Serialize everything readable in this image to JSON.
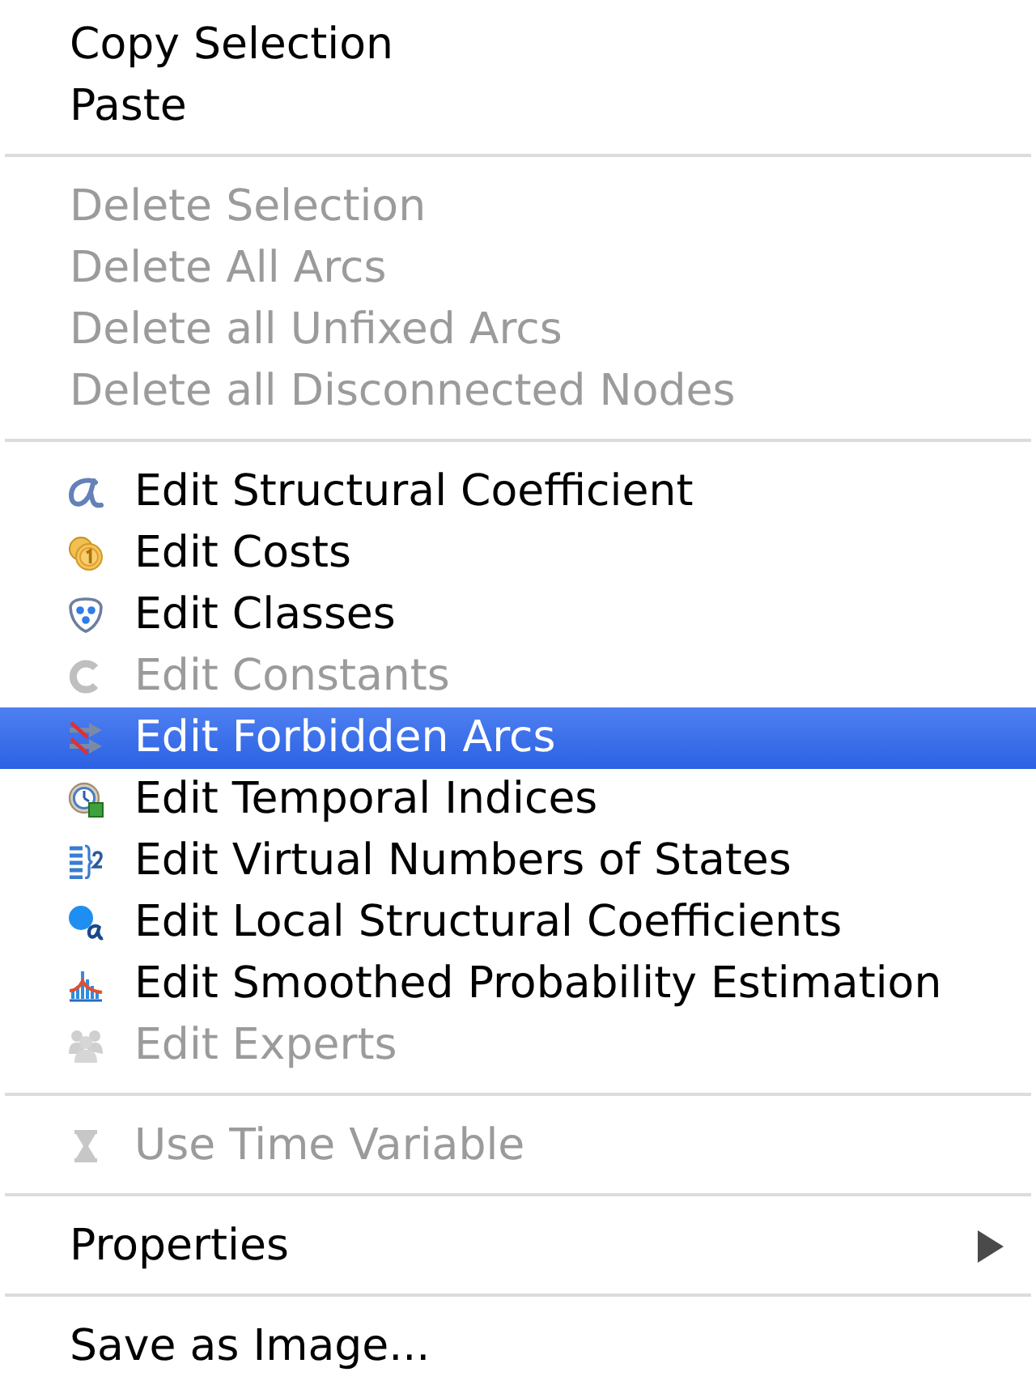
{
  "menu": {
    "sections": [
      {
        "items": [
          {
            "label": "Copy Selection",
            "disabled": false,
            "selected": false,
            "submenu": false
          },
          {
            "label": "Paste",
            "disabled": false,
            "selected": false,
            "submenu": false
          }
        ]
      },
      {
        "items": [
          {
            "label": "Delete Selection",
            "disabled": true,
            "selected": false,
            "submenu": false
          },
          {
            "label": "Delete All Arcs",
            "disabled": true,
            "selected": false,
            "submenu": false
          },
          {
            "label": "Delete all Unfixed Arcs",
            "disabled": true,
            "selected": false,
            "submenu": false
          },
          {
            "label": "Delete all Disconnected Nodes",
            "disabled": true,
            "selected": false,
            "submenu": false
          }
        ]
      },
      {
        "items": [
          {
            "label": "Edit Structural Coefficient",
            "disabled": false,
            "selected": false,
            "submenu": false
          },
          {
            "label": "Edit Costs",
            "disabled": false,
            "selected": false,
            "submenu": false
          },
          {
            "label": "Edit Classes",
            "disabled": false,
            "selected": false,
            "submenu": false
          },
          {
            "label": "Edit Constants",
            "disabled": true,
            "selected": false,
            "submenu": false
          },
          {
            "label": "Edit Forbidden Arcs",
            "disabled": false,
            "selected": true,
            "submenu": false
          },
          {
            "label": "Edit Temporal Indices",
            "disabled": false,
            "selected": false,
            "submenu": false
          },
          {
            "label": "Edit Virtual Numbers of States",
            "disabled": false,
            "selected": false,
            "submenu": false
          },
          {
            "label": "Edit Local Structural Coefficients",
            "disabled": false,
            "selected": false,
            "submenu": false
          },
          {
            "label": "Edit Smoothed Probability Estimation",
            "disabled": false,
            "selected": false,
            "submenu": false
          },
          {
            "label": "Edit Experts",
            "disabled": true,
            "selected": false,
            "submenu": false
          }
        ]
      },
      {
        "items": [
          {
            "label": "Use Time Variable",
            "disabled": true,
            "selected": false,
            "submenu": false
          }
        ]
      },
      {
        "items": [
          {
            "label": "Properties",
            "disabled": false,
            "selected": false,
            "submenu": true
          }
        ]
      },
      {
        "items": [
          {
            "label": "Save as Image...",
            "disabled": false,
            "selected": false,
            "submenu": false
          }
        ]
      }
    ]
  }
}
